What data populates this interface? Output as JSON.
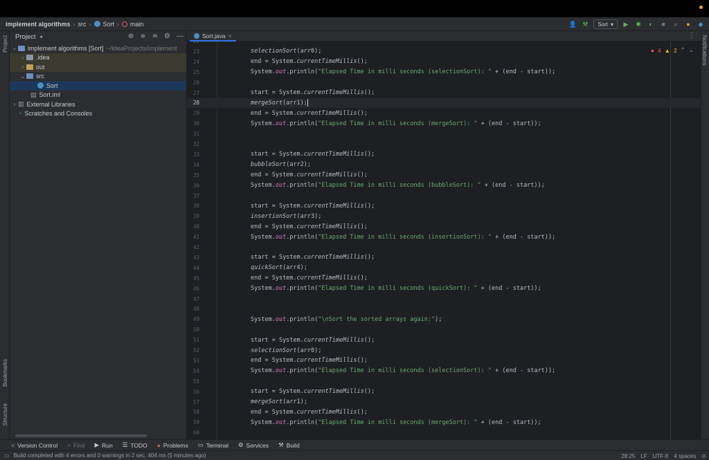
{
  "breadcrumb": {
    "project": "implement algorithms",
    "src": "src",
    "class": "Sort",
    "method": "main"
  },
  "toolbar": {
    "run_config": "Sort"
  },
  "colors": {
    "accent": "#3574f0",
    "error": "#db5c5c",
    "warning": "#e0b443",
    "string": "#6aab73"
  },
  "side_labels": {
    "project": "Project",
    "bookmarks": "Bookmarks",
    "structure": "Structure",
    "notifications": "Notifications"
  },
  "project_panel": {
    "title": "Project",
    "root_label": "implement algorithms [Sort]",
    "root_path": "~/IdeaProjects/implement",
    "idea": ".idea",
    "out": "out",
    "src": "src",
    "sort_class": "Sort",
    "sort_iml": "Sort.iml",
    "external_libraries": "External Libraries",
    "scratches": "Scratches and Consoles"
  },
  "editor": {
    "tab": "Sort.java",
    "errors": "4",
    "warnings": "2",
    "cursor_line": 28,
    "first_line_num": "22",
    "lines": [
      {
        "n": "23",
        "a": "selectionSort",
        "b": "(arr0);"
      },
      {
        "n": "24",
        "a": "end",
        "b": " = System.",
        "c": "currentTimeMillis",
        "d": "();"
      },
      {
        "n": "25",
        "a": "System.",
        "b": "out",
        "c": ".println(",
        "s": "\"Elapsed Time in milli seconds (selectionSort): \"",
        "e": " + (end - start));"
      },
      {
        "n": "26"
      },
      {
        "n": "27",
        "a": "start",
        "b": " = System.",
        "c": "currentTimeMillis",
        "d": "();"
      },
      {
        "n": "28",
        "a": "mergeSort",
        "b": "(arr1);"
      },
      {
        "n": "29",
        "a": "end",
        "b": " = System.",
        "c": "currentTimeMillis",
        "d": "();"
      },
      {
        "n": "30",
        "a": "System.",
        "b": "out",
        "c": ".println(",
        "s": "\"Elapsed Time in milli seconds (mergeSort): \"",
        "e": " + (end - start));"
      },
      {
        "n": "31"
      },
      {
        "n": "32"
      },
      {
        "n": "33",
        "a": "start",
        "b": " = System.",
        "c": "currentTimeMillis",
        "d": "();"
      },
      {
        "n": "34",
        "a": "bubbleSort",
        "b": "(arr2);"
      },
      {
        "n": "35",
        "a": "end",
        "b": " = System.",
        "c": "currentTimeMillis",
        "d": "();"
      },
      {
        "n": "36",
        "a": "System.",
        "b": "out",
        "c": ".println(",
        "s": "\"Elapsed Time in milli seconds (bubbleSort): \"",
        "e": " + (end - start));"
      },
      {
        "n": "37"
      },
      {
        "n": "38",
        "a": "start",
        "b": " = System.",
        "c": "currentTimeMillis",
        "d": "();"
      },
      {
        "n": "39",
        "a": "insertionSort",
        "b": "(arr3);"
      },
      {
        "n": "40",
        "a": "end",
        "b": " = System.",
        "c": "currentTimeMillis",
        "d": "();"
      },
      {
        "n": "41",
        "a": "System.",
        "b": "out",
        "c": ".println(",
        "s": "\"Elapsed Time in milli seconds (insertionSort): \"",
        "e": " + (end - start));"
      },
      {
        "n": "42"
      },
      {
        "n": "43",
        "a": "start",
        "b": " = System.",
        "c": "currentTimeMillis",
        "d": "();"
      },
      {
        "n": "44",
        "a": "quickSort",
        "b": "(arr4);"
      },
      {
        "n": "45",
        "a": "end",
        "b": " = System.",
        "c": "currentTimeMillis",
        "d": "();"
      },
      {
        "n": "46",
        "a": "System.",
        "b": "out",
        "c": ".println(",
        "s": "\"Elapsed Time in milli seconds (quickSort): \"",
        "e": " + (end - start));"
      },
      {
        "n": "47"
      },
      {
        "n": "48"
      },
      {
        "n": "49",
        "a": "System.",
        "b": "out",
        "c": ".println(",
        "s": "\"\\nSort the sorted arrays again:\"",
        "e": ");"
      },
      {
        "n": "50"
      },
      {
        "n": "51",
        "a": "start",
        "b": " = System.",
        "c": "currentTimeMillis",
        "d": "();"
      },
      {
        "n": "52",
        "a": "selectionSort",
        "b": "(arr0);"
      },
      {
        "n": "53",
        "a": "end",
        "b": " = System.",
        "c": "currentTimeMillis",
        "d": "();"
      },
      {
        "n": "54",
        "a": "System.",
        "b": "out",
        "c": ".println(",
        "s": "\"Elapsed Time in milli seconds (selectionSort): \"",
        "e": " + (end - start));"
      },
      {
        "n": "55"
      },
      {
        "n": "56",
        "a": "start",
        "b": " = System.",
        "c": "currentTimeMillis",
        "d": "();"
      },
      {
        "n": "57",
        "a": "mergeSort",
        "b": "(arr1);"
      },
      {
        "n": "58",
        "a": "end",
        "b": " = System.",
        "c": "currentTimeMillis",
        "d": "();"
      },
      {
        "n": "59",
        "a": "System.",
        "b": "out",
        "c": ".println(",
        "s": "\"Elapsed Time in milli seconds (mergeSort): \"",
        "e": " + (end - start));"
      },
      {
        "n": "60"
      }
    ]
  },
  "bottom_tools": [
    "Version Control",
    "Find",
    "Run",
    "TODO",
    "Problems",
    "Terminal",
    "Services",
    "Build"
  ],
  "status": {
    "message": "Build completed with 4 errors and 0 warnings in 2 sec, 404 ms (5 minutes ago)",
    "position": "28:25",
    "line_sep": "LF",
    "encoding": "UTF-8",
    "indent": "4 spaces"
  }
}
